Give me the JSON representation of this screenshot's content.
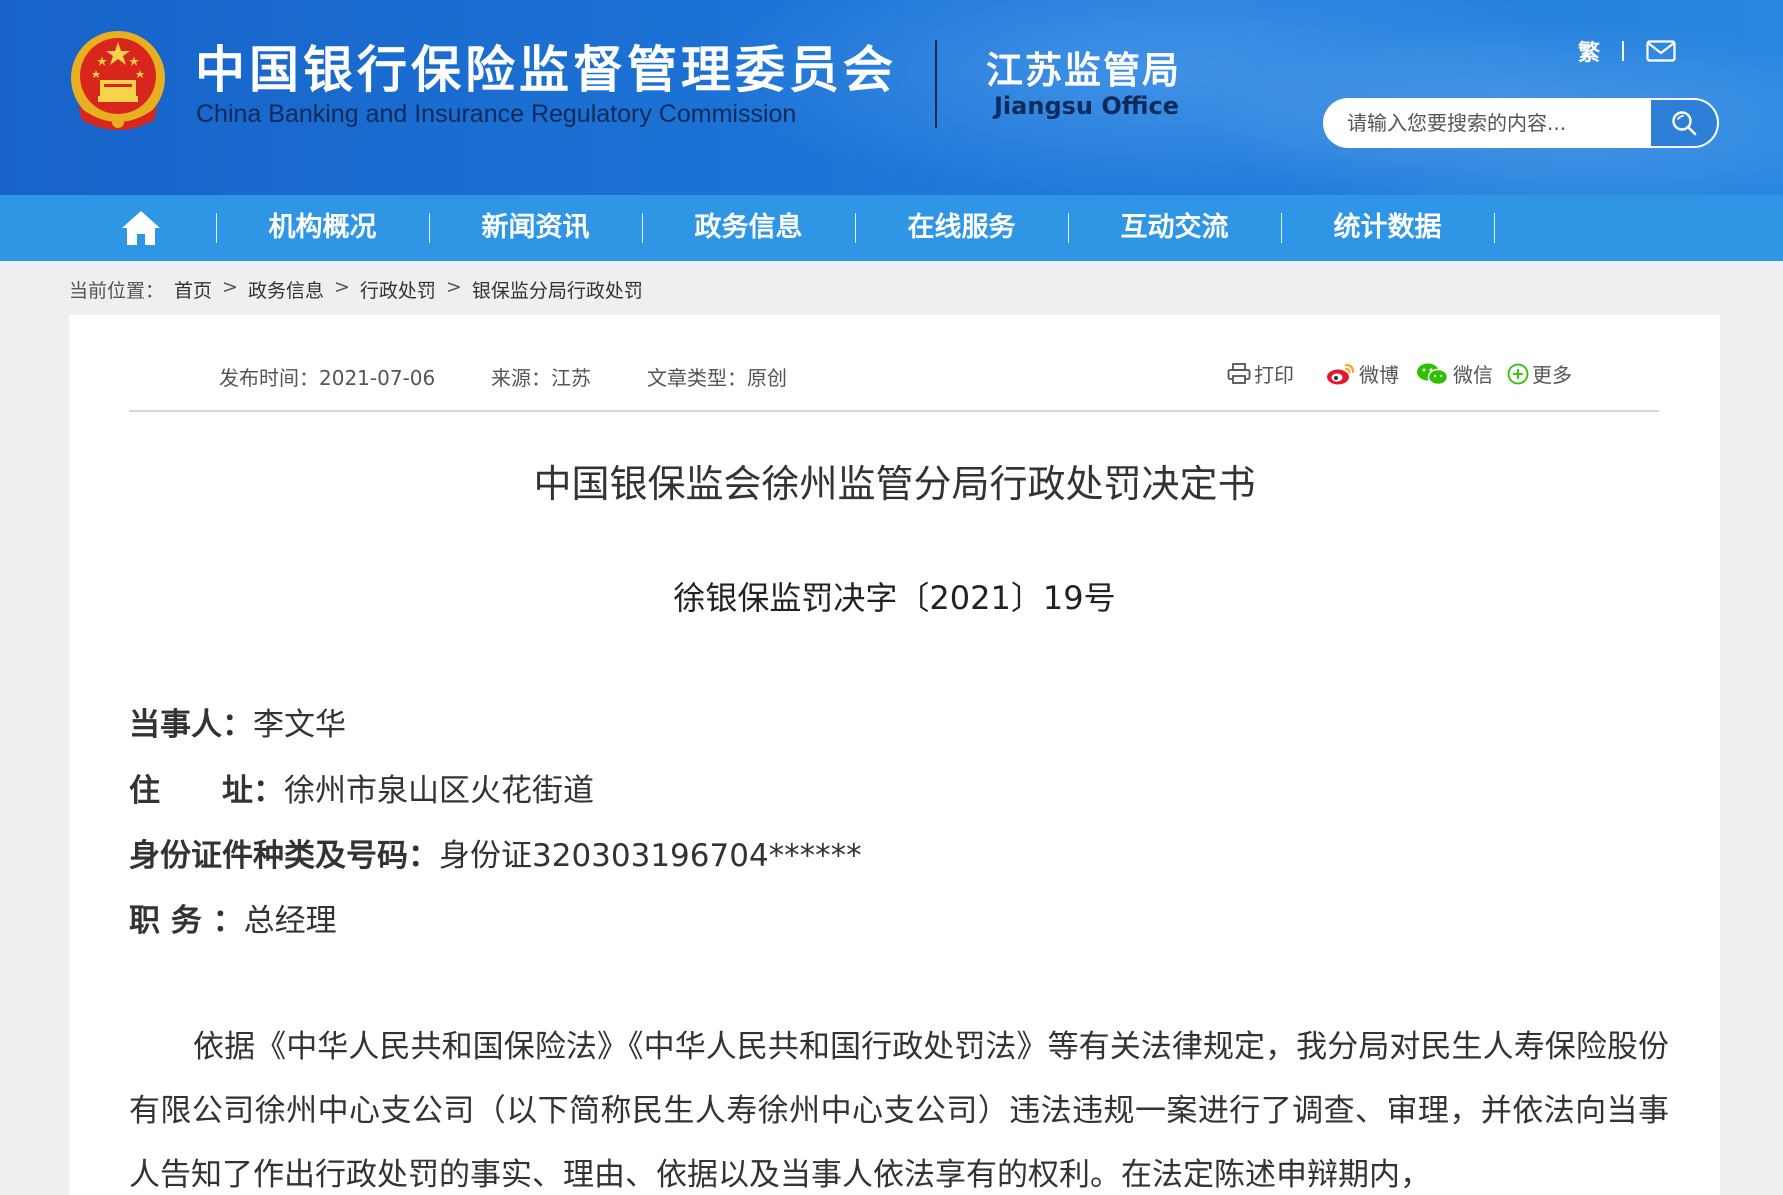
{
  "header": {
    "title_cn": "中国银行保险监督管理委员会",
    "title_en": "China Banking and Insurance Regulatory Commission",
    "office_cn": "江苏监管局",
    "office_en": "Jiangsu Office",
    "traditional_label": "繁",
    "mail_icon": "mail-icon",
    "search_placeholder": "请输入您要搜索的内容...",
    "search_icon": "search-icon"
  },
  "nav": {
    "home_icon": "home-icon",
    "items": [
      "机构概况",
      "新闻资讯",
      "政务信息",
      "在线服务",
      "互动交流",
      "统计数据"
    ]
  },
  "breadcrumb": {
    "label": "当前位置：",
    "items": [
      "首页",
      "政务信息",
      "行政处罚",
      "银保监分局行政处罚"
    ],
    "separator": ">"
  },
  "article": {
    "publish_time": "发布时间：2021-07-06",
    "source": "来源：江苏",
    "article_type": "文章类型：原创",
    "share": {
      "print": "打印",
      "weibo": "微博",
      "wechat": "微信",
      "more": "更多"
    },
    "title": "中国银保监会徐州监管分局行政处罚决定书",
    "doc_number": "徐银保监罚决字〔2021〕19号",
    "fields": [
      {
        "label": "当事人：",
        "value": "李文华"
      },
      {
        "label": "住　　址：",
        "value": "徐州市泉山区火花街道"
      },
      {
        "label": "身份证件种类及号码：",
        "value": "身份证320303196704******"
      },
      {
        "label": "职 务 ：",
        "value": "总经理"
      }
    ],
    "paragraph": "依据《中华人民共和国保险法》《中华人民共和国行政处罚法》等有关法律规定，我分局对民生人寿保险股份有限公司徐州中心支公司（以下简称民生人寿徐州中心支公司）违法违规一案进行了调查、审理，并依法向当事人告知了作出行政处罚的事实、理由、依据以及当事人依法享有的权利。在法定陈述申辩期内，"
  }
}
